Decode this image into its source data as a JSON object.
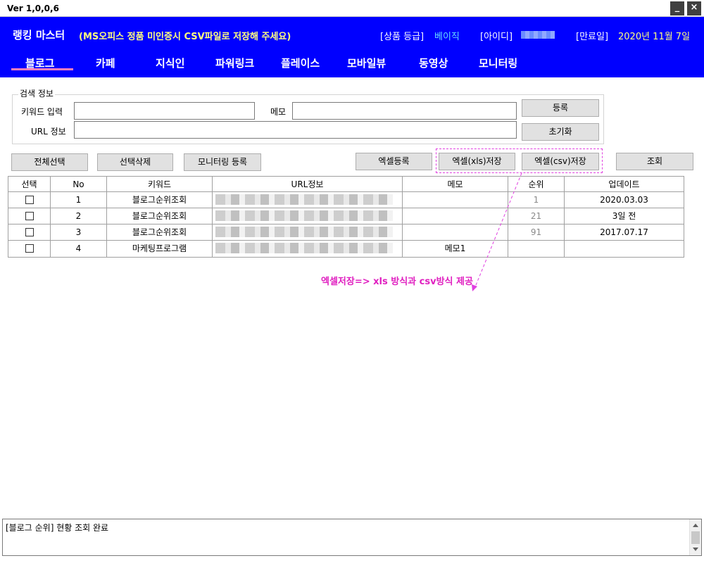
{
  "window": {
    "version": "Ver 1,0,0,6",
    "minimize": "_",
    "close": "×"
  },
  "header": {
    "app_title": "랭킹 마스터",
    "notice": "(MS오피스 정품 미인증시 CSV파일로 저장해 주세요)",
    "grade_label": "[상품 등급]",
    "grade_value": "베이직",
    "id_label": "[아이디]",
    "expire_label": "[만료일]",
    "expire_value": "2020년 11월 7일"
  },
  "tabs": [
    {
      "label": "블로그"
    },
    {
      "label": "카페"
    },
    {
      "label": "지식인"
    },
    {
      "label": "파워링크"
    },
    {
      "label": "플레이스"
    },
    {
      "label": "모바일뷰"
    },
    {
      "label": "동영상"
    },
    {
      "label": "모니터링"
    }
  ],
  "search": {
    "legend": "검색 정보",
    "keyword_label": "키워드 입력",
    "memo_label": "메모",
    "url_label": "URL 정보",
    "register_button": "등록",
    "reset_button": "초기화"
  },
  "toolbar": {
    "select_all": "전체선택",
    "delete_selected": "선택삭제",
    "monitoring_register": "모니터링 등록",
    "excel_register": "엑셀등록",
    "excel_xls_save": "엑셀(xls)저장",
    "excel_csv_save": "엑셀(csv)저장",
    "lookup": "조회"
  },
  "grid": {
    "columns": [
      "선택",
      "No",
      "키워드",
      "URL정보",
      "메모",
      "순위",
      "업데이트"
    ],
    "rows": [
      {
        "no": "1",
        "keyword": "블로그순위조회",
        "memo": "",
        "rank": "1",
        "updated": "2020.03.03"
      },
      {
        "no": "2",
        "keyword": "블로그순위조회",
        "memo": "",
        "rank": "21",
        "updated": "3일 전"
      },
      {
        "no": "3",
        "keyword": "블로그순위조회",
        "memo": "",
        "rank": "91",
        "updated": "2017.07.17"
      },
      {
        "no": "4",
        "keyword": "마케팅프로그램",
        "memo": "메모1",
        "rank": "",
        "updated": ""
      }
    ]
  },
  "annotation": "엑셀저장=> xls 방식과 csv방식 제공",
  "log": {
    "text": "[블로그 순위] 현황 조회 완료"
  },
  "colors": {
    "header_bg": "#0000ff",
    "tab_underline": "#ff7fbf",
    "annotation": "#e020c0",
    "notice": "#ffff80",
    "value": "#66ddff"
  }
}
